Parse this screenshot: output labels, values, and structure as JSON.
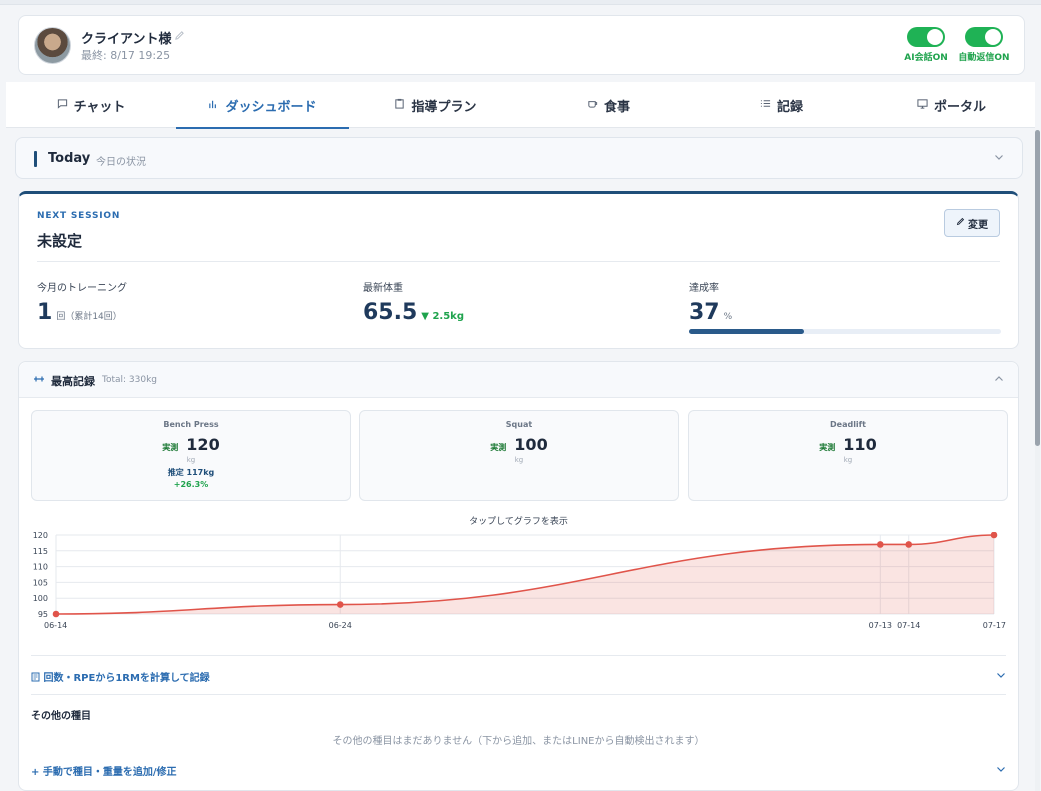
{
  "header": {
    "client_name": "クライアント様",
    "last_seen": "最終: 8/17 19:25",
    "toggles": [
      {
        "label": "AI会話ON",
        "on": true
      },
      {
        "label": "自動返信ON",
        "on": true
      }
    ],
    "accent_color": "#1fb255"
  },
  "tabs": [
    {
      "label": "チャット",
      "icon": "chat-icon",
      "active": false
    },
    {
      "label": "ダッシュボード",
      "icon": "chart-icon",
      "active": true
    },
    {
      "label": "指導プラン",
      "icon": "clipboard-icon",
      "active": false
    },
    {
      "label": "食事",
      "icon": "cup-icon",
      "active": false
    },
    {
      "label": "記録",
      "icon": "list-icon",
      "active": false
    },
    {
      "label": "ポータル",
      "icon": "monitor-icon",
      "active": false
    }
  ],
  "today": {
    "title": "Today",
    "subtitle": "今日の状況"
  },
  "session": {
    "label": "NEXT SESSION",
    "value": "未設定",
    "change_button": "変更",
    "stats": {
      "training": {
        "label": "今月のトレーニング",
        "value": "1",
        "unit": "回（累計14回）"
      },
      "weight": {
        "label": "最新体重",
        "value": "65.5",
        "delta": "▼ 2.5kg"
      },
      "achievement": {
        "label": "達成率",
        "value": "37",
        "unit": "%",
        "progress": 0.37
      }
    }
  },
  "records": {
    "title": "最高記録",
    "total": "Total: 330kg",
    "lifts": [
      {
        "name": "Bench Press",
        "tag": "実測",
        "value": "120",
        "unit": "kg",
        "estimate": "推定 117kg",
        "change": "+26.3%"
      },
      {
        "name": "Squat",
        "tag": "実測",
        "value": "100",
        "unit": "kg",
        "estimate": "",
        "change": ""
      },
      {
        "name": "Deadlift",
        "tag": "実測",
        "value": "110",
        "unit": "kg",
        "estimate": "",
        "change": ""
      }
    ],
    "chart_hint": "タップしてグラフを表示",
    "rm_calc": "回数・RPEから1RMを計算して記録",
    "other_title": "その他の種目",
    "other_empty": "その他の種目はまだありません（下から追加、またはLINEから自動検出されます）",
    "manual_add": "手動で種目・重量を追加/修正"
  },
  "chart_data": {
    "type": "area",
    "x": [
      "06-14",
      "06-24",
      "07-13",
      "07-14",
      "07-17"
    ],
    "series": [
      {
        "values": [
          95,
          98,
          117,
          117,
          120
        ],
        "color": "#e0544a"
      }
    ],
    "yticks": [
      95,
      100,
      105,
      110,
      115,
      120
    ],
    "ylim": [
      95,
      120
    ],
    "grid": true
  }
}
